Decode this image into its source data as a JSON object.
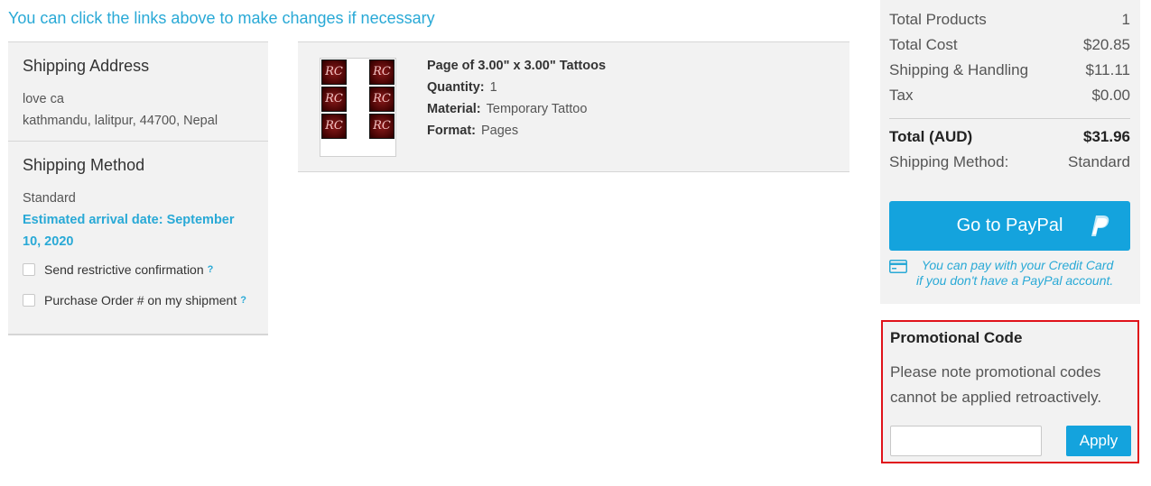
{
  "top_link": "You can click the links above to make changes if necessary",
  "shipping_address": {
    "title": "Shipping Address",
    "name": "love ca",
    "address": "kathmandu, lalitpur, 44700, Nepal"
  },
  "shipping_method": {
    "title": "Shipping Method",
    "method": "Standard",
    "arrival": "Estimated arrival date: September 10, 2020",
    "options": [
      {
        "label": "Send restrictive confirmation",
        "help": "?"
      },
      {
        "label": "Purchase Order # on my shipment",
        "help": "?"
      }
    ]
  },
  "product": {
    "title": "Page of 3.00\" x 3.00\" Tattoos",
    "quantity_label": "Quantity:",
    "quantity": "1",
    "material_label": "Material:",
    "material": "Temporary Tattoo",
    "format_label": "Format:",
    "format": "Pages",
    "tile_text": "RC"
  },
  "summary": {
    "rows": [
      {
        "label": "Total Products",
        "value": "1"
      },
      {
        "label": "Total Cost",
        "value": "$20.85"
      },
      {
        "label": "Shipping & Handling",
        "value": "$11.11"
      },
      {
        "label": "Tax",
        "value": "$0.00"
      }
    ],
    "total_label": "Total (AUD)",
    "total_value": "$31.96",
    "method_label": "Shipping Method:",
    "method_value": "Standard",
    "paypal_label": "Go to PayPal",
    "paypal_icon": "paypal-icon",
    "cc_icon": "credit-card-icon",
    "cc_note_1": "You can pay with your Credit Card",
    "cc_note_2": "if you don't have a PayPal account."
  },
  "promo": {
    "title": "Promotional Code",
    "note": "Please note promotional codes cannot be applied retroactively.",
    "input_value": "",
    "apply_label": "Apply"
  },
  "colors": {
    "accent": "#14a3dd",
    "link": "#29a9d6",
    "highlight_border": "#e0121a",
    "panel": "#f2f2f2"
  }
}
